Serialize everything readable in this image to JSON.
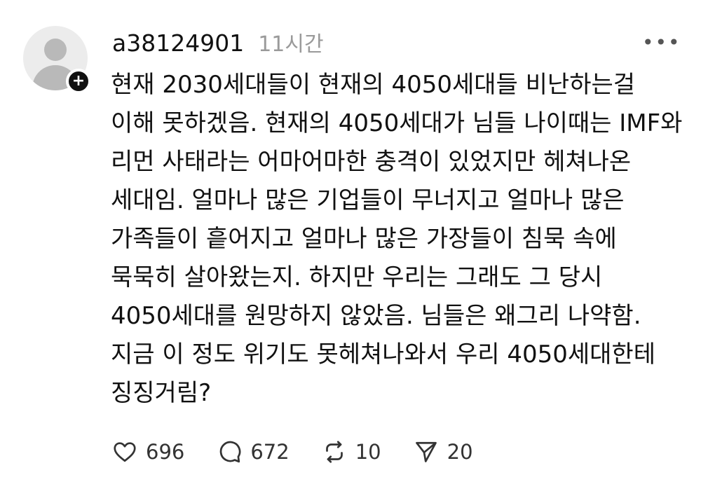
{
  "post": {
    "username": "a38124901",
    "timestamp": "11시간",
    "more_label": "•••",
    "follow_label": "+",
    "content_lines": [
      "현재 2030세대들이 현재의 4050세대들 비난하는걸",
      "이해 못하겠음. 현재의 4050세대가 님들 나이때는 IMF와",
      "리먼 사태라는 어마어마한 충격이 있었지만 헤쳐나온",
      "세대임. 얼마나 많은 기업들이 무너지고 얼마나 많은",
      "가족들이 흩어지고 얼마나 많은 가장들이 침묵 속에",
      "묵묵히 살아왔는지. 하지만 우리는 그래도 그 당시",
      "4050세대를 원망하지 않았음. 님들은 왜그리 나약함.",
      "지금 이 정도 위기도 못헤쳐나와서 우리 4050세대한테",
      "징징거림?"
    ],
    "actions": {
      "likes": {
        "icon": "heart-icon",
        "count": "696"
      },
      "replies": {
        "icon": "comment-icon",
        "count": "672"
      },
      "reposts": {
        "icon": "repost-icon",
        "count": "10"
      },
      "shares": {
        "icon": "send-icon",
        "count": "20"
      }
    }
  }
}
